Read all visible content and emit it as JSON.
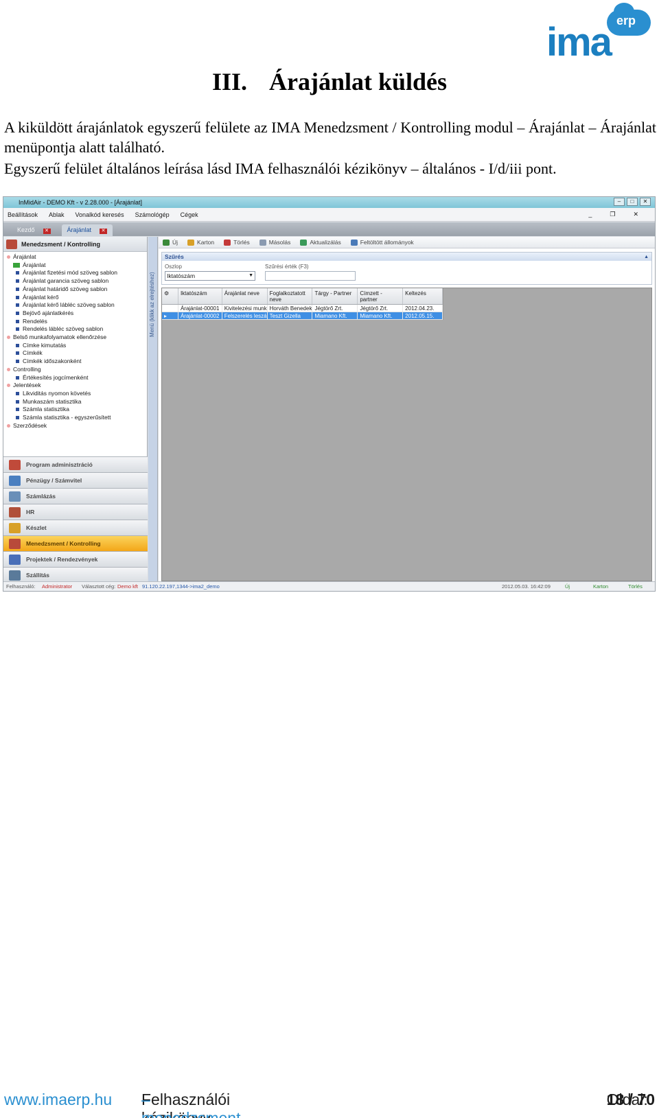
{
  "logo": {
    "main": "ima",
    "badge": "erp"
  },
  "heading": {
    "number": "III.",
    "title": "Árajánlat küldés"
  },
  "paragraphs": {
    "p1": "A kiküldött árajánlatok egyszerű felülete az IMA Menedzsment / Kontrolling modul – Árajánlat – Árajánlat menüpontja alatt található.",
    "p2": "Egyszerű felület általános leírása lásd IMA felhasználói kézikönyv – általános - I/d/iii pont."
  },
  "app": {
    "title": "InMidAir - DEMO Kft - v 2.28.000 - [Árajánlat]",
    "menu": [
      "Beállítások",
      "Ablak",
      "Vonalkód keresés",
      "Számológép",
      "Cégek"
    ],
    "tabs": [
      "Kezdő",
      "Árajánlat"
    ],
    "left_panel_title": "Menedzsment / Kontrolling",
    "tree": [
      {
        "label": "Árajánlat",
        "level": 0
      },
      {
        "label": "Árajánlat",
        "level": 1
      },
      {
        "label": "Árajánlat fizetési mód szöveg sablon",
        "level": 2
      },
      {
        "label": "Árajánlat garancia szöveg sablon",
        "level": 2
      },
      {
        "label": "Árajánlat határidő szöveg sablon",
        "level": 2
      },
      {
        "label": "Árajánlat kérő",
        "level": 2
      },
      {
        "label": "Árajánlat kérő lábléc szöveg sablon",
        "level": 2
      },
      {
        "label": "Bejövő ajánlatkérés",
        "level": 2
      },
      {
        "label": "Rendelés",
        "level": 2
      },
      {
        "label": "Rendelés lábléc szöveg sablon",
        "level": 2
      },
      {
        "label": "Belső munkafolyamatok ellenőrzése",
        "level": 0
      },
      {
        "label": "Címke kimutatás",
        "level": 2
      },
      {
        "label": "Címkék",
        "level": 2
      },
      {
        "label": "Címkék időszakonként",
        "level": 2
      },
      {
        "label": "Controlling",
        "level": 0
      },
      {
        "label": "Értékesítés jogcímenként",
        "level": 2
      },
      {
        "label": "Jelentések",
        "level": 0
      },
      {
        "label": "Likviditás nyomon követés",
        "level": 2
      },
      {
        "label": "Munkaszám statisztika",
        "level": 2
      },
      {
        "label": "Számla statisztika",
        "level": 2
      },
      {
        "label": "Számla statisztika - egyszerűsített",
        "level": 2
      },
      {
        "label": "Szerződések",
        "level": 0
      }
    ],
    "modules": [
      {
        "label": "Program adminisztráció",
        "color": "#c04a3a"
      },
      {
        "label": "Pénzügy / Számvitel",
        "color": "#4a7fc0"
      },
      {
        "label": "Számlázás",
        "color": "#6a8fb8"
      },
      {
        "label": "HR",
        "color": "#b0503a"
      },
      {
        "label": "Készlet",
        "color": "#d8a028"
      },
      {
        "label": "Menedzsment / Kontrolling",
        "color": "#b84a3a"
      },
      {
        "label": "Projektek / Rendezvények",
        "color": "#4a6fb8"
      },
      {
        "label": "Szállítás",
        "color": "#5a7a9a"
      }
    ],
    "vertical_label": "Menü (klikk az elrejtéshez)",
    "toolbar": [
      "Új",
      "Karton",
      "Törlés",
      "Másolás",
      "Aktualizálás",
      "Feltöltött állományok"
    ],
    "filter": {
      "title": "Szűrés",
      "column_label": "Oszlop",
      "value_label": "Szűrési érték (F3)",
      "column_value": "Iktatószám"
    },
    "grid": {
      "headers": [
        "Iktatószám",
        "Árajánlat neve",
        "Foglalkoztatott neve",
        "Tárgy - Partner",
        "Címzett - partner",
        "Keltezés"
      ],
      "rows": [
        [
          "Árajánlat-00001",
          "Kivitelezési munkála",
          "Horváth Benedek",
          "Jégtörő Zrt.",
          "Jégtörő Zrt.",
          "2012.04.23."
        ],
        [
          "Árajánlat-00002",
          "Felszerelés leszállítá",
          "Teszt Gizella",
          "Miamano Kft.",
          "Miamano Kft.",
          "2012.05.15."
        ]
      ]
    },
    "status": {
      "user_label": "Felhasználó:",
      "user": "Administrator",
      "company_label": "Választott cég:",
      "company": "Demo kft",
      "server": "91.120.22.197,1344->ima2_demo",
      "datetime": "2012.05.03. 16:42:09",
      "new": "Új",
      "card": "Karton",
      "delete": "Törlés"
    }
  },
  "footer": {
    "url": "www.imaerp.hu",
    "book": "Felhasználói kézikönyv",
    "dash": " – menedzsment / kontrolling",
    "page_label": "Oldal: ",
    "page": "18 / 70"
  }
}
